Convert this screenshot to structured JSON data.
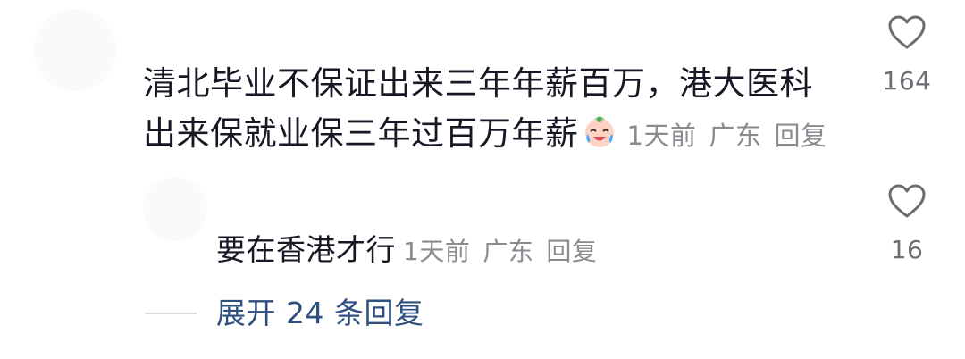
{
  "comment": {
    "text": "清北毕业不保证出来三年年薪百万，港大医科出来保就业保三年过百万年薪",
    "emoji_icon": "crying-laughing-emoji-icon",
    "time": "1天前",
    "location": "广东",
    "reply_label": "回复",
    "likes": "164"
  },
  "reply": {
    "text": "要在香港才行",
    "time": "1天前",
    "location": "广东",
    "reply_label": "回复",
    "likes": "16"
  },
  "expand": {
    "label": "展开 24 条回复"
  },
  "colors": {
    "text": "#161823",
    "meta": "#8a8b91",
    "link": "#2f4f7f",
    "icon": "#6b6c72"
  }
}
